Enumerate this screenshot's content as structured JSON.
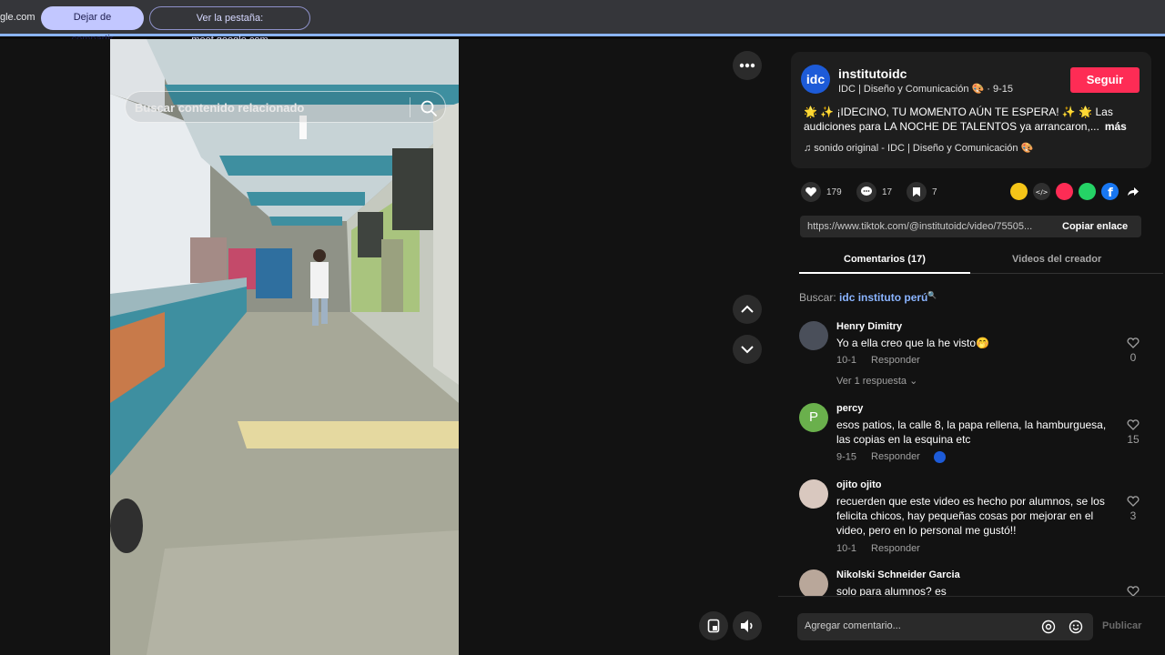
{
  "browser_bar": {
    "domain_fragment": "gle.com",
    "stop_sharing_label": "Dejar de compartir",
    "view_tab_label": "Ver la pestaña: meet.google.com"
  },
  "video": {
    "search_placeholder": "Buscar contenido relacionado"
  },
  "post": {
    "username": "institutoidc",
    "avatar_text": "idc",
    "subtitle": "IDC | Diseño y Comunicación 🎨 · 9-15",
    "follow_label": "Seguir",
    "description": "🌟 ✨ ¡IDECINO, TU MOMENTO AÚN TE ESPERA! ✨ 🌟 Las audiciones para LA NOCHE DE TALENTOS ya arrancaron,...",
    "more_label": "más",
    "music": "♫  sonido original - IDC | Diseño y Comunicación 🎨"
  },
  "actions": {
    "likes": "179",
    "comments": "17",
    "saves": "7"
  },
  "link": {
    "url": "https://www.tiktok.com/@institutoidc/video/75505...",
    "copy_label": "Copiar enlace"
  },
  "tabs": {
    "comments": "Comentarios (17)",
    "creator_videos": "Videos del creador"
  },
  "search_hint": {
    "prefix": "Buscar:",
    "query": "idc instituto perú"
  },
  "comments": [
    {
      "name": "Henry Dimitry",
      "text": "Yo a ella creo que la he visto🤭",
      "date": "10-1",
      "reply": "Responder",
      "likes": "0",
      "replies": "Ver 1 respuesta"
    },
    {
      "name": "percy",
      "text": "esos patios, la calle 8, la papa rellena, la hamburguesa, las copias en la esquina etc",
      "date": "9-15",
      "reply": "Responder",
      "likes": "15",
      "avatar_letter": "P"
    },
    {
      "name": "ojito ojito",
      "text": "recuerden que este video es hecho por alumnos, se los felicita chicos, hay pequeñas cosas por mejorar en el video, pero en lo personal me gustó!!",
      "date": "10-1",
      "reply": "Responder",
      "likes": "3"
    },
    {
      "name": "Nikolski Schneider Garcia",
      "text": "solo para alumnos? es",
      "likes": ""
    }
  ],
  "composer": {
    "placeholder": "Agregar comentario...",
    "publish_label": "Publicar"
  },
  "colors": {
    "accent_pink": "#fe2c55",
    "share_bar_blue": "#8ab4f8",
    "link_blue": "#8ab4ff"
  },
  "icons": [
    "search-icon",
    "more-options-icon",
    "chevron-up-icon",
    "chevron-down-icon",
    "heart-icon",
    "comment-icon",
    "bookmark-icon",
    "embed-icon",
    "whatsapp-icon",
    "facebook-icon",
    "share-arrow-icon",
    "mention-icon",
    "emoji-icon",
    "volume-icon",
    "pip-icon"
  ]
}
